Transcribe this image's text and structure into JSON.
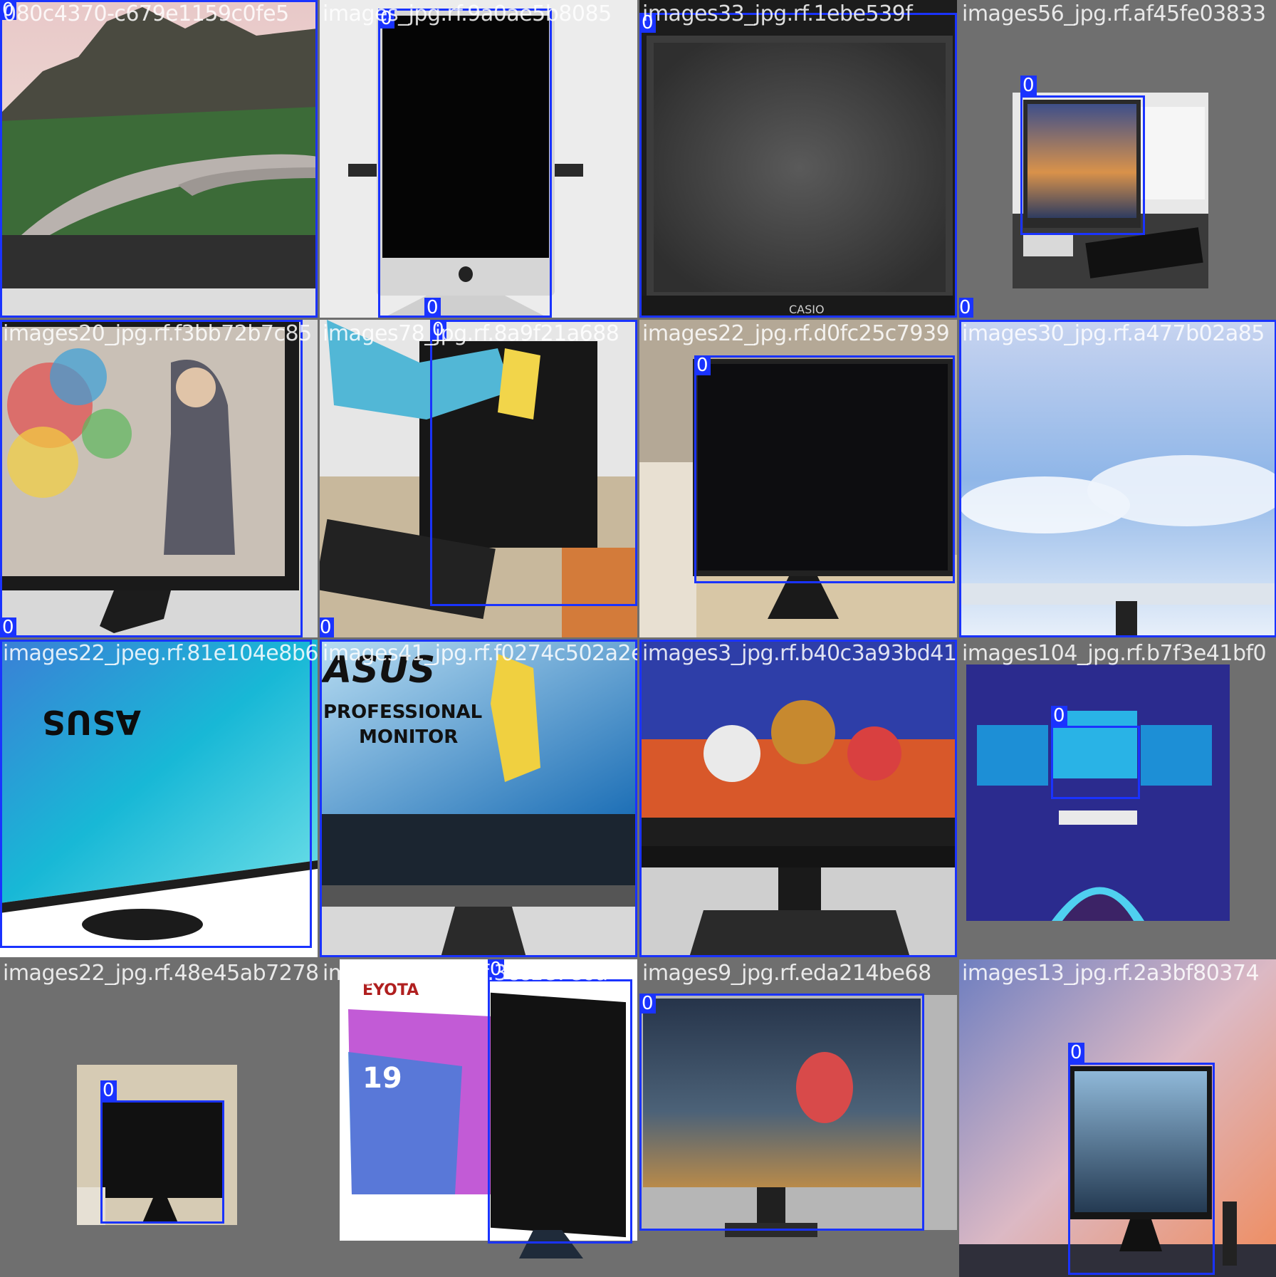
{
  "class_label": "0",
  "box_color": "#1a33ff",
  "tiles": [
    {
      "filename": "080c4370-c679e1159c0fe5",
      "icon": "mountain-walkway-monitor"
    },
    {
      "filename": "images_jpg.rf.9a0ae5b8085",
      "icon": "imac-black-screen"
    },
    {
      "filename": "images33_jpg.rf.1ebe539f",
      "icon": "dusty-monitor-closeup"
    },
    {
      "filename": "images56_jpg.rf.af45fe03833",
      "icon": "monitor-on-desk-city"
    },
    {
      "filename": "images20_jpg.rf.f3bb72b7c85",
      "icon": "graffiti-girl-monitor"
    },
    {
      "filename": "images78_jpg.rf.8a9f21a688",
      "icon": "monitor-cleaning-glove"
    },
    {
      "filename": "images22_jpg.rf.d0fc25c7939",
      "icon": "black-monitor-room"
    },
    {
      "filename": "images30_jpg.rf.a477b02a85",
      "icon": "sky-clouds-monitor"
    },
    {
      "filename": "images22_jpeg.rf.81e104e8b6",
      "icon": "asus-teal-monitor"
    },
    {
      "filename": "images41_jpg.rf.f0274c502a2e",
      "icon": "asus-professional-monitor"
    },
    {
      "filename": "images3_jpg.rf.b40c3a93bd41",
      "icon": "toy-story-monitor"
    },
    {
      "filename": "images104_jpg.rf.b7f3e41bf0",
      "icon": "three-monitor-illustration"
    },
    {
      "filename": "images22_jpg.rf.48e45ab7278",
      "icon": "small-black-monitor"
    },
    {
      "filename": "images15_jpg.rf.3cc1e7e6a",
      "icon": "eyota-box-monitor"
    },
    {
      "filename": "images9_jpg.rf.eda214be68",
      "icon": "balloon-wallpaper-monitor"
    },
    {
      "filename": "images13_jpg.rf.2a3bf80374",
      "icon": "desk-setup-monitor"
    }
  ],
  "overlay_text": {
    "eyota_brand": "EYOTA",
    "eyota_size": "19",
    "asus_logo": "ASUS",
    "asus_tagline_1": "PROFESSIONAL",
    "asus_tagline_2": "MONITOR"
  }
}
